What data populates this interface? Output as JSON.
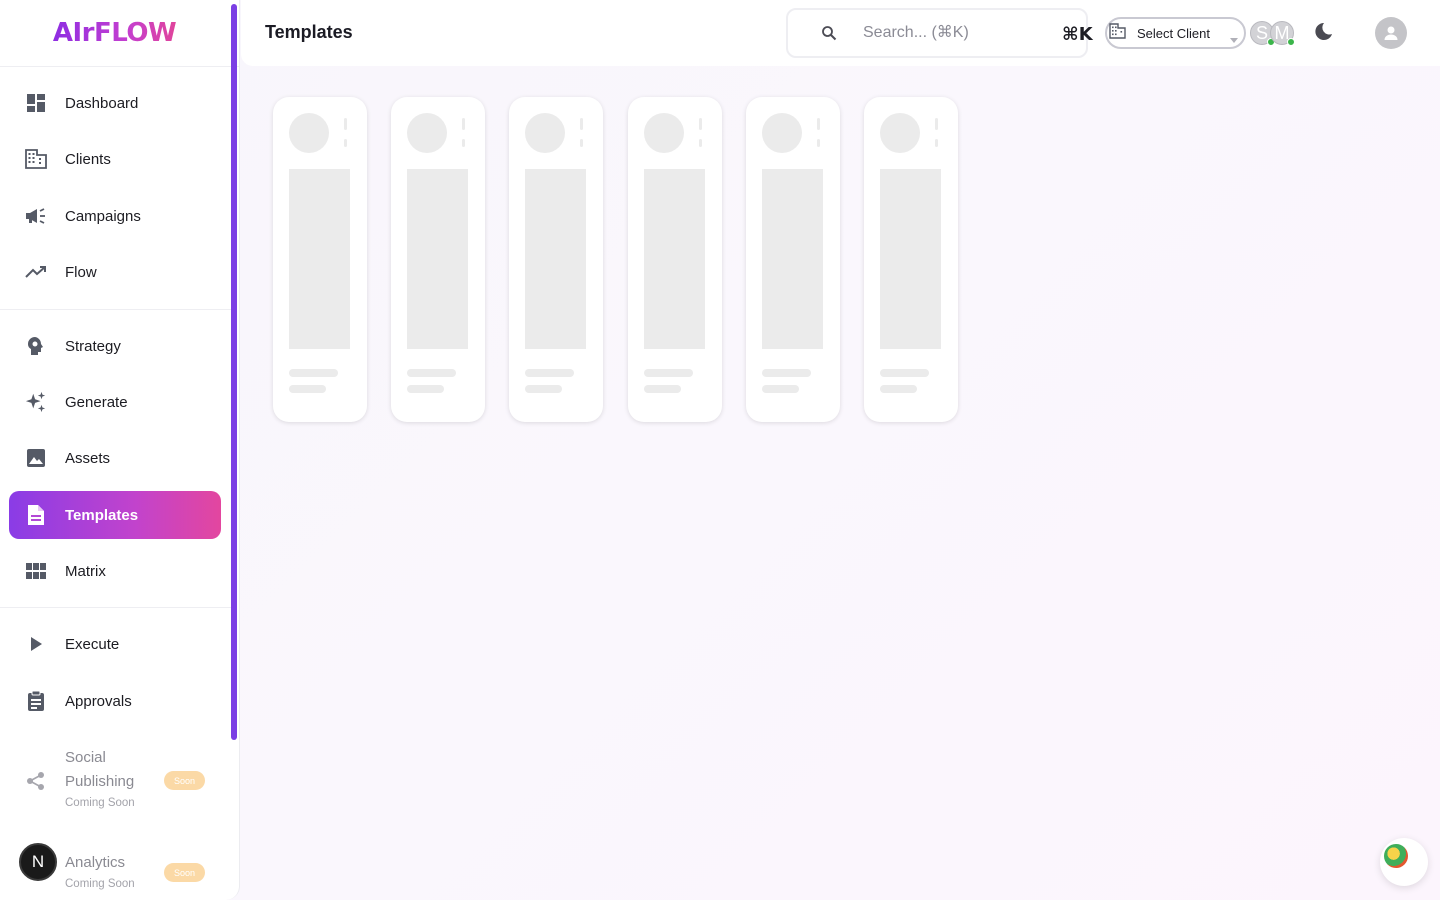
{
  "brand": {
    "name": "AIrFLOW"
  },
  "sidebar": {
    "items": [
      {
        "label": "Dashboard",
        "icon": "dashboard-icon"
      },
      {
        "label": "Clients",
        "icon": "building-icon"
      },
      {
        "label": "Campaigns",
        "icon": "megaphone-icon"
      },
      {
        "label": "Flow",
        "icon": "trending-up-icon"
      },
      {
        "label": "Strategy",
        "icon": "brain-head-icon"
      },
      {
        "label": "Generate",
        "icon": "sparkles-icon"
      },
      {
        "label": "Assets",
        "icon": "image-icon"
      },
      {
        "label": "Templates",
        "icon": "document-icon",
        "active": true
      },
      {
        "label": "Matrix",
        "icon": "grid-icon"
      },
      {
        "label": "Execute",
        "icon": "play-icon"
      },
      {
        "label": "Approvals",
        "icon": "clipboard-icon"
      }
    ],
    "coming_soon": [
      {
        "label_line1": "Social",
        "label_line2": "Publishing",
        "sub": "Coming Soon",
        "badge": "Soon",
        "icon": "share-icon"
      },
      {
        "label_line1": "Analytics",
        "sub": "Coming Soon",
        "badge": "Soon",
        "icon": "chart-icon"
      }
    ],
    "next_badge": "N"
  },
  "header": {
    "title": "Templates",
    "search": {
      "placeholder": "Search... (⌘K)",
      "shortcut": "⌘K"
    },
    "client_select": {
      "label": "Select Client"
    },
    "presence": [
      {
        "initial": "S"
      },
      {
        "initial": "M"
      }
    ]
  },
  "colors": {
    "accent_start": "#8a3ce6",
    "accent_end": "#e3469f",
    "scrollbar": "#7b3fe4",
    "online": "#3bb54a",
    "soon_badge": "#fbd9a6"
  },
  "skeleton_cards": {
    "count": 6
  }
}
